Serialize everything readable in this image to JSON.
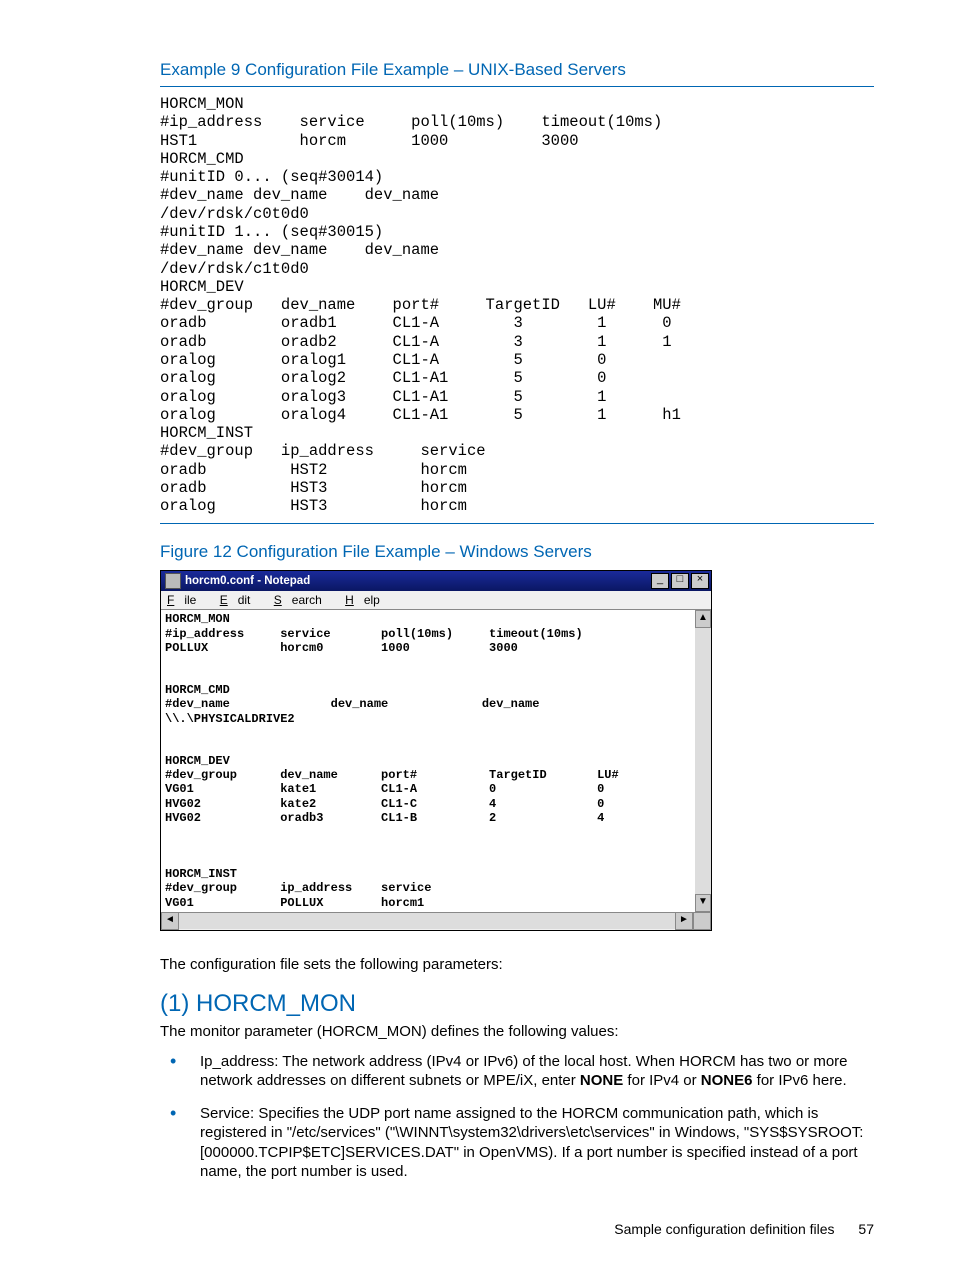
{
  "example_title": "Example 9 Configuration File Example – UNIX-Based Servers",
  "code_block": "HORCM_MON\n#ip_address    service     poll(10ms)    timeout(10ms)\nHST1           horcm       1000          3000\nHORCM_CMD\n#unitID 0... (seq#30014)\n#dev_name dev_name    dev_name\n/dev/rdsk/c0t0d0\n#unitID 1... (seq#30015)\n#dev_name dev_name    dev_name\n/dev/rdsk/c1t0d0\nHORCM_DEV\n#dev_group   dev_name    port#     TargetID   LU#    MU#\noradb        oradb1      CL1-A        3        1      0\noradb        oradb2      CL1-A        3        1      1\noralog       oralog1     CL1-A        5        0\noralog       oralog2     CL1-A1       5        0\noralog       oralog3     CL1-A1       5        1\noralog       oralog4     CL1-A1       5        1      h1\nHORCM_INST\n#dev_group   ip_address     service\noradb         HST2          horcm\noradb         HST3          horcm\noralog        HST3          horcm",
  "figure_title": "Figure 12 Configuration File Example – Windows Servers",
  "notepad": {
    "title": "horcm0.conf - Notepad",
    "menu": {
      "file": "File",
      "edit": "Edit",
      "search": "Search",
      "help": "Help"
    },
    "controls": {
      "min": "_",
      "max": "□",
      "close": "×"
    },
    "scroll": {
      "up": "▲",
      "down": "▼",
      "left": "◄",
      "right": "►"
    },
    "content": "HORCM_MON\n#ip_address     service       poll(10ms)     timeout(10ms)\nPOLLUX          horcm0        1000           3000\n\n\nHORCM_CMD\n#dev_name              dev_name             dev_name\n\\\\.\\PHYSICALDRIVE2\n\n\nHORCM_DEV\n#dev_group      dev_name      port#          TargetID       LU#\nVG01            kate1         CL1-A          0              0\nHVG02           kate2         CL1-C          4              0\nHVG02           oradb3        CL1-B          2              4\n\n\n\nHORCM_INST\n#dev_group      ip_address    service\nVG01            POLLUX        horcm1\n"
  },
  "intro_text": "The configuration file sets the following parameters:",
  "section_heading": "(1) HORCM_MON",
  "section_intro": "The monitor parameter (HORCM_MON) defines the following values:",
  "bullets": [
    {
      "label": "Ip_address",
      "text_before": ": The network address (IPv4 or IPv6) of the local host. When HORCM has two or more network addresses on different subnets or MPE/iX, enter ",
      "strong1": "NONE",
      "mid": " for IPv4 or ",
      "strong2": "NONE6",
      "after": " for IPv6 here."
    },
    {
      "label": "Service",
      "text": ": Specifies the UDP port name assigned to the HORCM communication path, which is registered in \"/etc/services\" (\"\\WINNT\\system32\\drivers\\etc\\services\" in Windows, \"SYS$SYSROOT:[000000.TCPIP$ETC]SERVICES.DAT\" in OpenVMS). If a port number is specified instead of a port name, the port number is used."
    }
  ],
  "footer_text": "Sample configuration definition files",
  "page_number": "57"
}
